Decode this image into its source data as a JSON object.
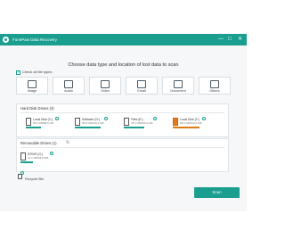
{
  "window": {
    "title": "FonePaw Data Recovery",
    "controls": [
      "—",
      "□",
      "✕"
    ]
  },
  "heading": "Choose data type and location of lost data to scan",
  "check_all_label": "Check all file types",
  "file_types": [
    {
      "label": "Image",
      "icon": "image-icon"
    },
    {
      "label": "Audio",
      "icon": "audio-icon"
    },
    {
      "label": "Video",
      "icon": "video-icon"
    },
    {
      "label": "Email",
      "icon": "email-icon"
    },
    {
      "label": "Document",
      "icon": "document-icon"
    },
    {
      "label": "Others",
      "icon": "others-icon"
    }
  ],
  "hard_drives": {
    "title": "Hard Disk Drives (4)",
    "drives": [
      {
        "name": "Local Disk (C:)",
        "size": "58.3 GB/99.5 GB",
        "fill": 0.55
      },
      {
        "name": "Software (D:)",
        "size": "95.8 GB/100.0 GB",
        "fill": 0.95
      },
      {
        "name": "Files (E:)",
        "size": "78.1 GB/100.0 GB",
        "fill": 0.78
      },
      {
        "name": "Local Disk (F:)",
        "size": "99.6 GB/100.0 GB",
        "fill": 1.0
      }
    ]
  },
  "removable_drives": {
    "title": "Removable Drives (1)",
    "drives": [
      {
        "name": "DRIVE (G:)",
        "size": "13.1 MB/28.8 MB",
        "fill": 0.45
      }
    ]
  },
  "recycle_bin_label": "Recycle Bin",
  "scan_label": "Scan",
  "colors": {
    "accent": "#1a9e8f",
    "warning": "#e07b1a"
  }
}
